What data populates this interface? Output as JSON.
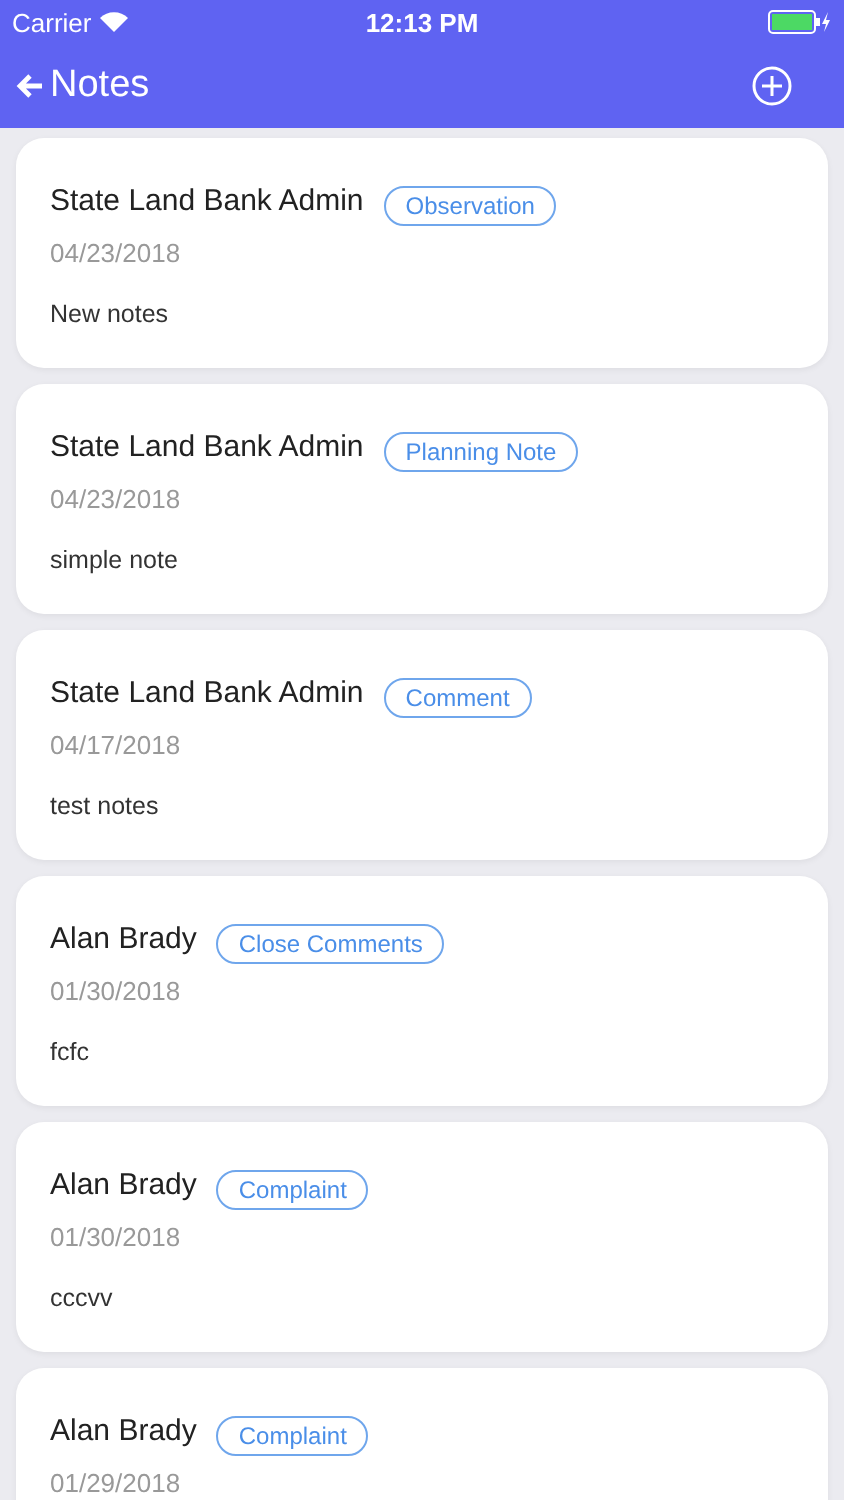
{
  "status_bar": {
    "carrier": "Carrier",
    "time": "12:13 PM"
  },
  "nav": {
    "title": "Notes"
  },
  "notes": [
    {
      "author": "State Land Bank Admin",
      "tag": "Observation",
      "date": "04/23/2018",
      "text": "New notes"
    },
    {
      "author": "State Land Bank Admin",
      "tag": "Planning Note",
      "date": "04/23/2018",
      "text": "simple note"
    },
    {
      "author": "State Land Bank Admin",
      "tag": "Comment",
      "date": "04/17/2018",
      "text": "test notes"
    },
    {
      "author": "Alan Brady",
      "tag": "Close Comments",
      "date": "01/30/2018",
      "text": "fcfc"
    },
    {
      "author": "Alan Brady",
      "tag": "Complaint",
      "date": "01/30/2018",
      "text": "cccvv"
    },
    {
      "author": "Alan Brady",
      "tag": "Complaint",
      "date": "01/29/2018"
    }
  ]
}
